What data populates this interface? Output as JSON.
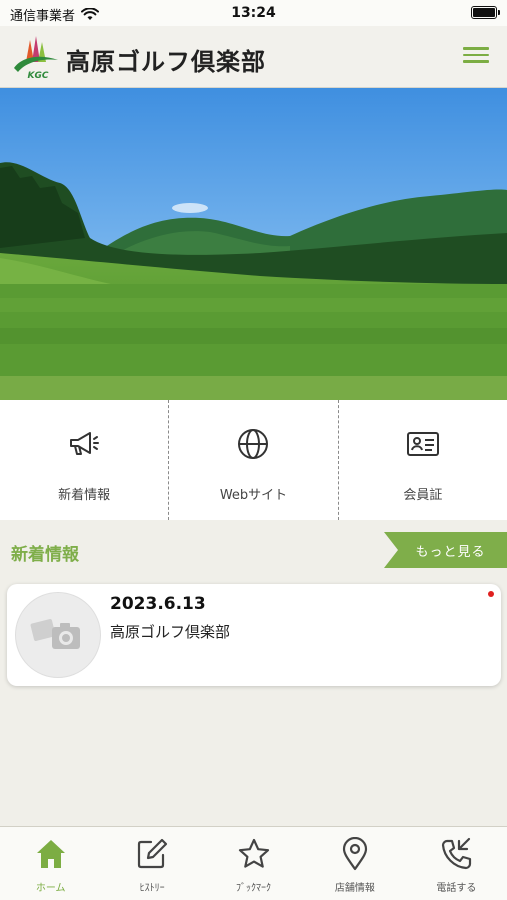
{
  "status_bar": {
    "carrier": "通信事業者",
    "time": "13:24"
  },
  "header": {
    "logo_text": "KGC",
    "brand_name": "高原ゴルフ倶楽部",
    "menu_icon": "hamburger-icon"
  },
  "hero": {
    "image": "golf-course-photo"
  },
  "quick_links": [
    {
      "label": "新着情報",
      "icon": "megaphone-icon"
    },
    {
      "label": "Webサイト",
      "icon": "globe-icon"
    },
    {
      "label": "会員証",
      "icon": "id-card-icon"
    }
  ],
  "news": {
    "title": "新着情報",
    "more_label": "もっと見る",
    "items": [
      {
        "date": "2023.6.13",
        "text": "高原ゴルフ倶楽部",
        "thumbnail": "no-photo-icon",
        "unread": true
      }
    ]
  },
  "tab_bar": {
    "items": [
      {
        "label": "ホーム",
        "icon": "home-icon",
        "active": true
      },
      {
        "label": "ﾋｽﾄﾘｰ",
        "icon": "edit-icon",
        "active": false
      },
      {
        "label": "ﾌﾞｯｸﾏｰｸ",
        "icon": "star-icon",
        "active": false
      },
      {
        "label": "店舗情報",
        "icon": "map-pin-icon",
        "active": false
      },
      {
        "label": "電話する",
        "icon": "phone-icon",
        "active": false
      }
    ]
  },
  "colors": {
    "accent": "#7cad43",
    "background": "#f0efe9",
    "unread": "#e0201f"
  }
}
